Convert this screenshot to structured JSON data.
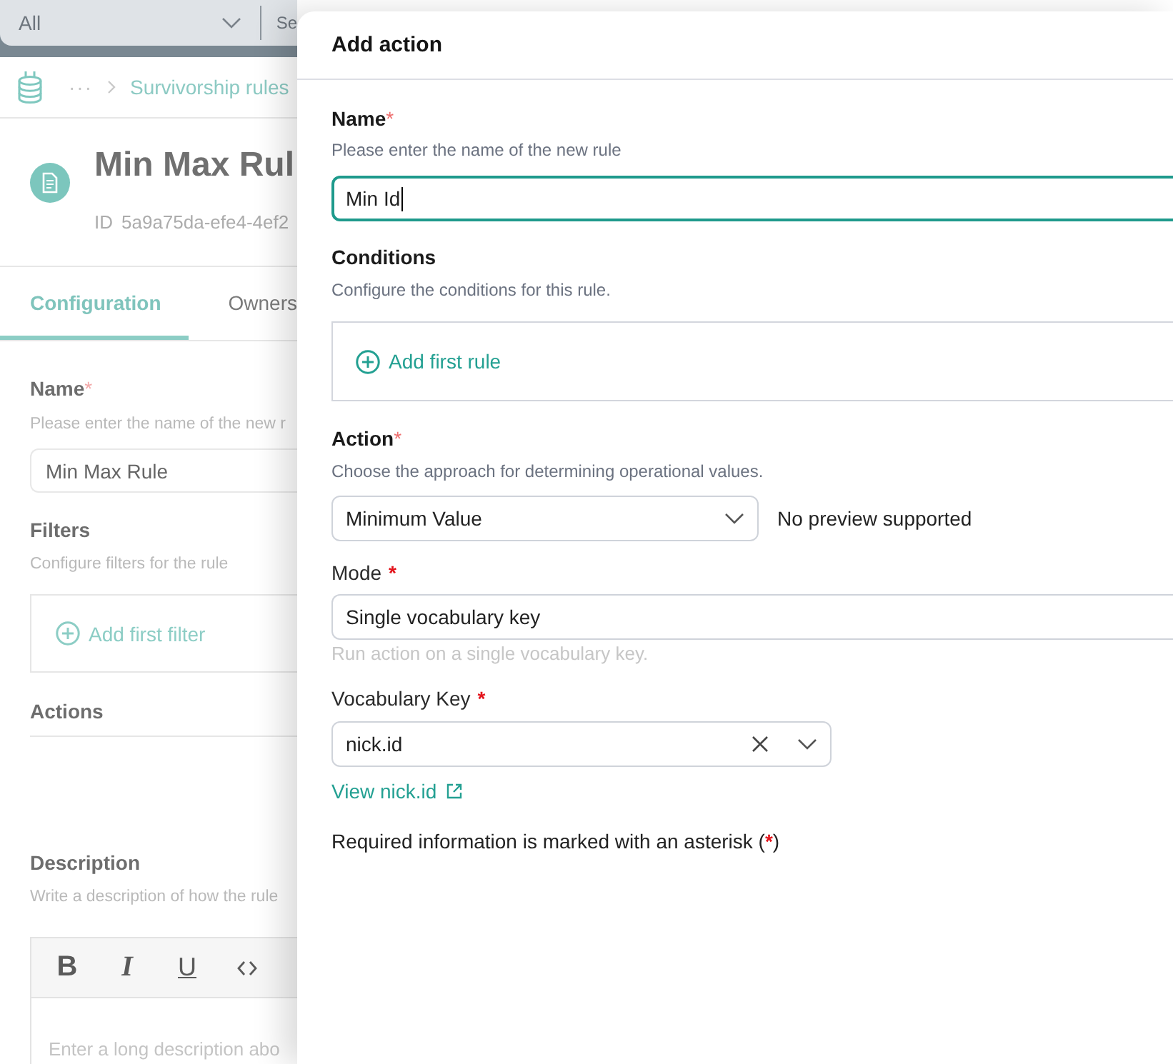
{
  "top_bar": {
    "scope": "All",
    "search_text": "Se"
  },
  "breadcrumb": {
    "ellipsis": "···",
    "current": "Survivorship rules"
  },
  "rule": {
    "title": "Min Max Rul",
    "id_label": "ID",
    "id_value": "5a9a75da-efe4-4ef2"
  },
  "tabs": [
    {
      "label": "Configuration",
      "selected": true
    },
    {
      "label": "Owners",
      "selected": false
    }
  ],
  "configuration": {
    "name": {
      "label": "Name",
      "required_mark": "*",
      "hint": "Please enter the name of the new r",
      "value": "Min Max Rule"
    },
    "filters": {
      "label": "Filters",
      "hint": "Configure filters for the rule",
      "add_label": "Add first filter"
    },
    "actions": {
      "label": "Actions"
    },
    "description": {
      "label": "Description",
      "hint": "Write a description of how the rule",
      "toolbar": [
        {
          "kind": "bold",
          "label": "B"
        },
        {
          "kind": "italic",
          "label": "I"
        },
        {
          "kind": "underline",
          "label": "U"
        },
        {
          "kind": "code"
        }
      ],
      "placeholder": "Enter a long description abo"
    }
  },
  "drawer": {
    "title": "Add action",
    "name": {
      "label": "Name",
      "required_mark": "*",
      "hint": "Please enter the name of the new rule",
      "value": "Min Id",
      "focused": true
    },
    "conditions": {
      "label": "Conditions",
      "hint": "Configure the conditions for this rule.",
      "add_label": "Add first rule"
    },
    "action": {
      "label": "Action",
      "required_mark": "*",
      "hint": "Choose the approach for determining operational values.",
      "value": "Minimum Value",
      "note": "No preview supported"
    },
    "mode": {
      "label": "Mode",
      "required_mark": "*",
      "value": "Single vocabulary key",
      "help": "Run action on a single vocabulary key."
    },
    "vocabulary_key": {
      "label": "Vocabulary Key",
      "required_mark": "*",
      "value": "nick.id",
      "clearable": true
    },
    "view_link": "View nick.id",
    "footnote": {
      "before": "Required information is marked with an asterisk (",
      "mark": "*",
      "after": ")"
    }
  }
}
